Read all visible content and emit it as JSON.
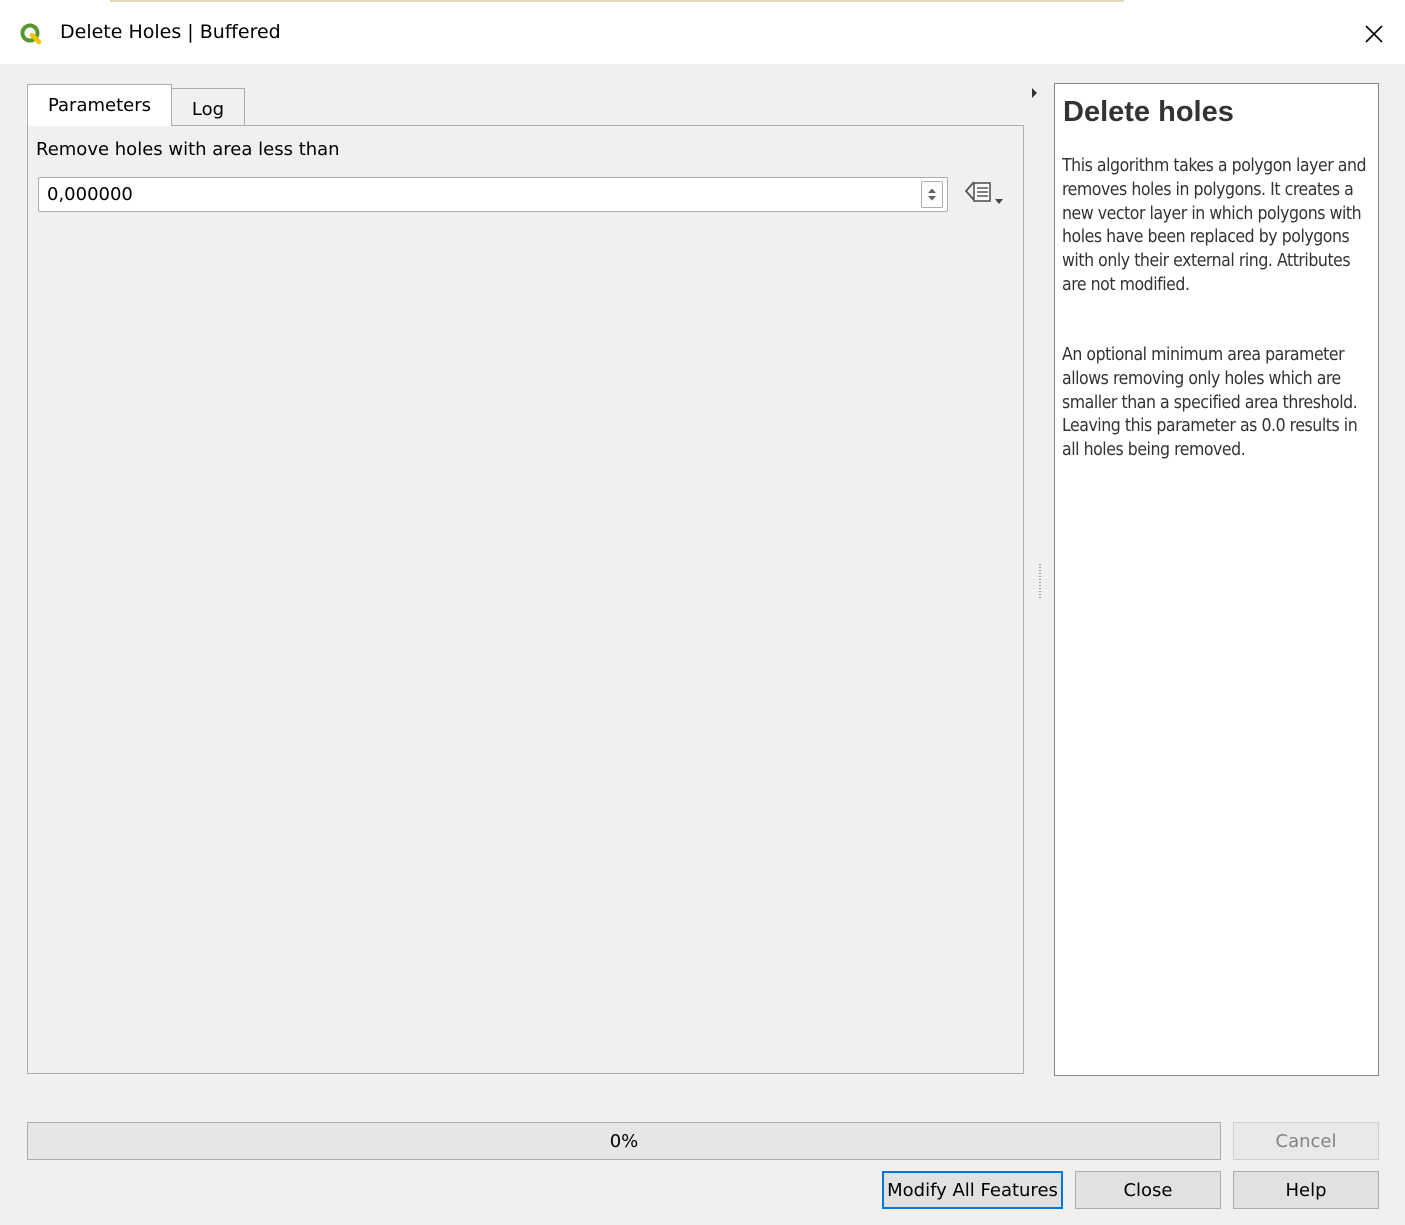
{
  "window": {
    "title": "Delete Holes | Buffered",
    "app_icon": "qgis-logo-icon",
    "close_icon": "close-icon"
  },
  "tabs": [
    {
      "label": "Parameters",
      "active": true
    },
    {
      "label": "Log",
      "active": false
    }
  ],
  "parameters": {
    "min_area_label": "Remove holes with area less than",
    "min_area_value": "0,000000",
    "spin_icon": "spin-up-down-icon",
    "expression_icon": "data-defined-override-icon"
  },
  "help": {
    "title": "Delete holes",
    "paragraphs": [
      "This algorithm takes a polygon layer and removes holes in polygons. It creates a new vector layer in which polygons with holes have been replaced by polygons with only their external ring. Attributes are not modified.",
      "An optional minimum area parameter allows removing only holes which are smaller than a specified area threshold. Leaving this parameter as 0.0 results in all holes being removed."
    ]
  },
  "progress": {
    "value": 0,
    "label": "0%"
  },
  "buttons": {
    "cancel": "Cancel",
    "modify_all": "Modify All Features",
    "close": "Close",
    "help": "Help"
  },
  "colors": {
    "accent": "#0078d7",
    "qgis_green": "#589632",
    "qgis_yellow": "#ee7913"
  }
}
